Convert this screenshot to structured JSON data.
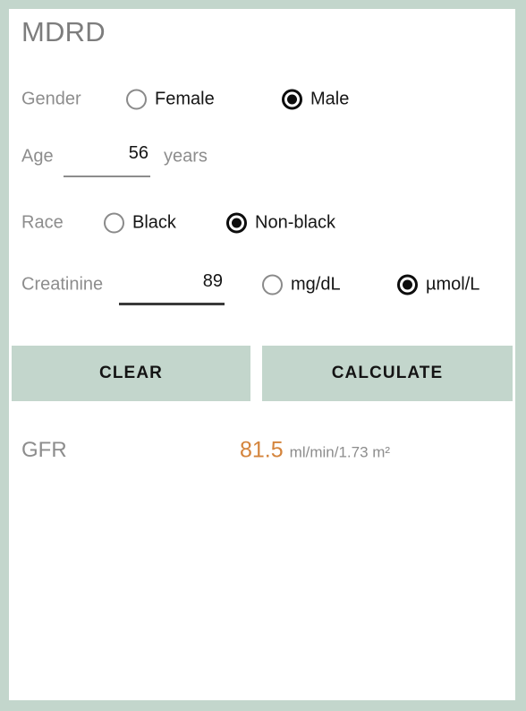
{
  "app": {
    "title": "MDRD"
  },
  "form": {
    "gender": {
      "label": "Gender",
      "options": [
        {
          "label": "Female",
          "selected": false
        },
        {
          "label": "Male",
          "selected": true
        }
      ]
    },
    "age": {
      "label": "Age",
      "value": "56",
      "unit": "years"
    },
    "race": {
      "label": "Race",
      "options": [
        {
          "label": "Black",
          "selected": false
        },
        {
          "label": "Non-black",
          "selected": true
        }
      ]
    },
    "creatinine": {
      "label": "Creatinine",
      "value": "89",
      "units": [
        {
          "label": "mg/dL",
          "selected": false
        },
        {
          "label": "µmol/L",
          "selected": true
        }
      ]
    }
  },
  "actions": {
    "clear_label": "CLEAR",
    "calculate_label": "CALCULATE"
  },
  "result": {
    "label": "GFR",
    "value": "81.5",
    "unit": "ml/min/1.73 m²"
  },
  "colors": {
    "page_border": "#c3d6cc",
    "card": "#ffffff",
    "label_grey": "#8d8d8d",
    "value_dark": "#151515",
    "result_orange": "#d4843c",
    "button_bg": "#c3d6cc"
  }
}
